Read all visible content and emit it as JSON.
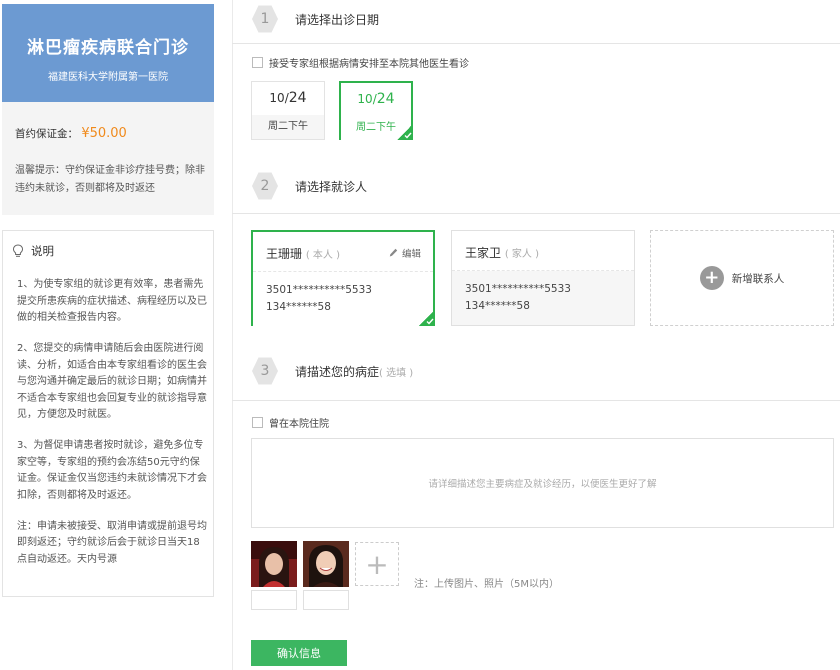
{
  "hospital": {
    "name": "淋巴瘤疾病联合门诊",
    "affiliation": "福建医科大学附属第一医院"
  },
  "fee": {
    "label": "首约保证金：",
    "value": "¥50.00",
    "tip": "温馨提示：守约保证金非诊疗挂号费；除非违约未就诊，否则都将及时返还"
  },
  "notice": {
    "title": "说明",
    "paragraphs": [
      "1、为使专家组的就诊更有效率，患者需先提交所患疾病的症状描述、病程经历以及已做的相关检查报告内容。",
      "2、您提交的病情申请随后会由医院进行阅读、分析，如适合由本专家组看诊的医生会与您沟通并确定最后的就诊日期；如病情并不适合本专家组也会回复专业的就诊指导意见，方便您及时就医。",
      "3、为督促申请患者按时就诊，避免多位专家空等，专家组的预约会冻结50元守约保证金。保证金仅当您违约未就诊情况下才会扣除，否则都将及时返还。",
      "注：申请未被接受、取消申请或提前退号均即刻返还；守约就诊后会于就诊日当天18点自动返还。天内号源"
    ]
  },
  "steps": {
    "s1": {
      "num": "1",
      "title": "请选择出诊日期"
    },
    "s2": {
      "num": "2",
      "title": "请选择就诊人"
    },
    "s3": {
      "num": "3",
      "title": "请描述您的病症",
      "optional": "( 选填 )"
    }
  },
  "accept_other_label": "接受专家组根据病情安排至本院其他医生看诊",
  "dates": [
    {
      "month": "10/",
      "day": "24",
      "slot": "周二下午",
      "selected": false
    },
    {
      "month": "10/",
      "day": "24",
      "slot": "周二下午",
      "selected": true
    }
  ],
  "patients": [
    {
      "name": "王珊珊",
      "relation": "( 本人 )",
      "edit": "编辑",
      "id_no": "3501**********5533",
      "phone": "134******58",
      "selected": true
    },
    {
      "name": "王家卫",
      "relation": "( 家人 )",
      "id_no": "3501**********5533",
      "phone": "134******58",
      "selected": false
    }
  ],
  "add_patient_label": "新增联系人",
  "hospitalized_label": "曾在本院住院",
  "description_placeholder": "请详细描述您主要病症及就诊经历，以便医生更好了解",
  "upload_note": "注：上传图片、照片（5M以内）",
  "confirm_label": "确认信息",
  "colors": {
    "banner": "#6c9ad2",
    "accent_green": "#2eb24c",
    "fee_orange": "#f08a1c",
    "button_green": "#3cb661"
  }
}
